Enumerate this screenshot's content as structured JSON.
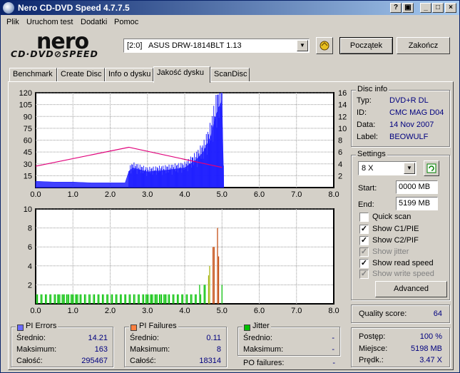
{
  "title": "Nero CD-DVD Speed 4.7.7.5",
  "menu": [
    "Plik",
    "Uruchom test",
    "Dodatki",
    "Pomoc"
  ],
  "logo": {
    "brand": "nero",
    "product": "CD·DVD⊘SPEED"
  },
  "drive": {
    "selected": "[2:0]   ASUS DRW-1814BLT 1.13"
  },
  "buttons": {
    "start": "Początek",
    "end": "Zakończ",
    "advanced": "Advanced"
  },
  "tabs": [
    "Benchmark",
    "Create Disc",
    "Info o dysku",
    "Jakość dysku",
    "ScanDisc"
  ],
  "active_tab": "Jakość dysku",
  "disc_info": {
    "title": "Disc info",
    "rows": [
      {
        "label": "Typ:",
        "value": "DVD+R DL"
      },
      {
        "label": "ID:",
        "value": "CMC MAG D04"
      },
      {
        "label": "Data:",
        "value": "14 Nov 2007"
      },
      {
        "label": "Label:",
        "value": "BEOWULF"
      }
    ]
  },
  "settings": {
    "title": "Settings",
    "speed": "8 X",
    "start_label": "Start:",
    "start_value": "0000 MB",
    "end_label": "End:",
    "end_value": "5199 MB",
    "checks": [
      {
        "label": "Quick scan",
        "checked": false,
        "enabled": true
      },
      {
        "label": "Show C1/PIE",
        "checked": true,
        "enabled": true
      },
      {
        "label": "Show C2/PIF",
        "checked": true,
        "enabled": true
      },
      {
        "label": "Show jitter",
        "checked": true,
        "enabled": false
      },
      {
        "label": "Show read speed",
        "checked": true,
        "enabled": true
      },
      {
        "label": "Show write speed",
        "checked": true,
        "enabled": false
      }
    ]
  },
  "quality": {
    "label": "Quality score:",
    "value": "64"
  },
  "progress": {
    "rows": [
      {
        "label": "Postęp:",
        "value": "100 %"
      },
      {
        "label": "Miejsce:",
        "value": "5198 MB"
      },
      {
        "label": "Prędk.:",
        "value": "3.47 X"
      }
    ]
  },
  "pi_errors": {
    "title": "PI Errors",
    "color": "#6b6bff",
    "rows": [
      {
        "label": "Średnio:",
        "value": "14.21"
      },
      {
        "label": "Maksimum:",
        "value": "163"
      },
      {
        "label": "Całość:",
        "value": "295467"
      }
    ]
  },
  "pi_failures": {
    "title": "PI Failures",
    "color": "#ff8040",
    "rows": [
      {
        "label": "Średnio:",
        "value": "0.11"
      },
      {
        "label": "Maksimum:",
        "value": "8"
      },
      {
        "label": "Całość:",
        "value": "18314"
      }
    ]
  },
  "jitter": {
    "title": "Jitter",
    "color": "#00c000",
    "rows": [
      {
        "label": "Średnio:",
        "value": "-"
      },
      {
        "label": "Maksimum:",
        "value": "-"
      }
    ]
  },
  "po_failures": {
    "label": "PO failures:",
    "value": "-"
  },
  "chart_data": [
    {
      "type": "area",
      "x_ticks": [
        "0.0",
        "1.0",
        "2.0",
        "3.0",
        "4.0",
        "5.0",
        "6.0",
        "7.0",
        "8.0"
      ],
      "xlim": [
        0,
        8
      ],
      "y_left_ticks": [
        "120",
        "105",
        "90",
        "75",
        "60",
        "45",
        "30",
        "15"
      ],
      "ylim_left": [
        0,
        120
      ],
      "y_right_ticks": [
        "16",
        "14",
        "12",
        "10",
        "8",
        "6",
        "4",
        "2"
      ],
      "ylim_right": [
        0,
        16
      ],
      "grid": true,
      "series": [
        {
          "color": "#2020ff",
          "x": [
            0.0,
            0.5,
            1.0,
            1.5,
            2.0,
            2.4,
            2.5,
            2.6,
            3.0,
            3.5,
            4.0,
            4.3,
            4.5,
            4.7,
            4.8,
            4.9,
            5.0,
            5.05
          ],
          "y": [
            8,
            7,
            7,
            6,
            6,
            6,
            20,
            25,
            20,
            22,
            25,
            35,
            45,
            65,
            85,
            100,
            110,
            0
          ]
        },
        {
          "color": "#e0007a",
          "axis": "right",
          "x": [
            0.0,
            2.5,
            5.0
          ],
          "y": [
            3.6,
            6.8,
            3.4
          ]
        }
      ]
    },
    {
      "type": "bar",
      "x_ticks": [
        "0.0",
        "1.0",
        "2.0",
        "3.0",
        "4.0",
        "5.0",
        "6.0",
        "7.0",
        "8.0"
      ],
      "xlim": [
        0,
        8
      ],
      "y_ticks": [
        "10",
        "8",
        "6",
        "4",
        "2"
      ],
      "ylim": [
        0,
        10
      ],
      "grid": true,
      "series": [
        {
          "color": "#00c000",
          "x": [
            0.0,
            0.3,
            0.6,
            0.9,
            1.2,
            1.5,
            1.8,
            2.1,
            2.4,
            2.7,
            3.0,
            3.3,
            3.6,
            3.9,
            4.2,
            4.5,
            4.7,
            4.8,
            4.85,
            4.9,
            4.95,
            5.0
          ],
          "y": [
            1,
            1,
            1,
            1,
            1,
            1,
            1,
            1,
            1,
            1,
            1,
            1,
            1,
            1,
            1,
            2,
            4,
            6,
            8,
            8,
            7,
            3
          ]
        }
      ]
    }
  ]
}
